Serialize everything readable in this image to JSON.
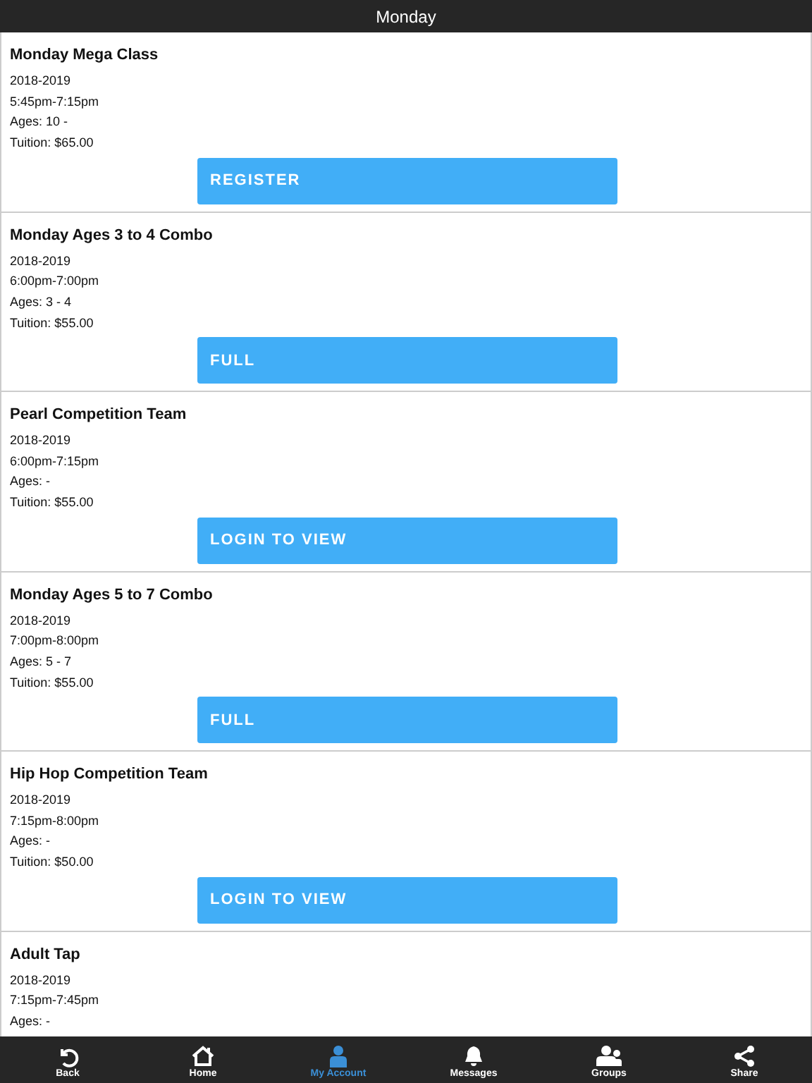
{
  "header": {
    "title": "Monday"
  },
  "classes": [
    {
      "name": "Monday Mega Class",
      "season": "2018-2019",
      "time": "5:45pm-7:15pm",
      "ages": "Ages: 10 -",
      "tuition": "Tuition: $65.00",
      "action": "REGISTER"
    },
    {
      "name": "Monday Ages 3 to 4 Combo",
      "season": "2018-2019",
      "time": "6:00pm-7:00pm",
      "ages": "Ages: 3 - 4",
      "tuition": "Tuition: $55.00",
      "action": "FULL"
    },
    {
      "name": "Pearl Competition Team",
      "season": "2018-2019",
      "time": "6:00pm-7:15pm",
      "ages": "Ages: -",
      "tuition": "Tuition: $55.00",
      "action": "LOGIN TO VIEW"
    },
    {
      "name": "Monday Ages 5 to 7 Combo",
      "season": "2018-2019",
      "time": "7:00pm-8:00pm",
      "ages": "Ages: 5 - 7",
      "tuition": "Tuition: $55.00",
      "action": "FULL"
    },
    {
      "name": "Hip Hop Competition Team",
      "season": "2018-2019",
      "time": "7:15pm-8:00pm",
      "ages": "Ages: -",
      "tuition": "Tuition: $50.00",
      "action": "LOGIN TO VIEW"
    },
    {
      "name": "Adult Tap",
      "season": "2018-2019",
      "time": "7:15pm-7:45pm",
      "ages": "Ages: -"
    }
  ],
  "nav": [
    {
      "kind": "back",
      "label": "Back",
      "selected": false
    },
    {
      "kind": "home",
      "label": "Home",
      "selected": false
    },
    {
      "kind": "account",
      "label": "My Account",
      "selected": true
    },
    {
      "kind": "messages",
      "label": "Messages",
      "selected": false
    },
    {
      "kind": "groups",
      "label": "Groups",
      "selected": false
    },
    {
      "kind": "share",
      "label": "Share",
      "selected": false
    }
  ]
}
